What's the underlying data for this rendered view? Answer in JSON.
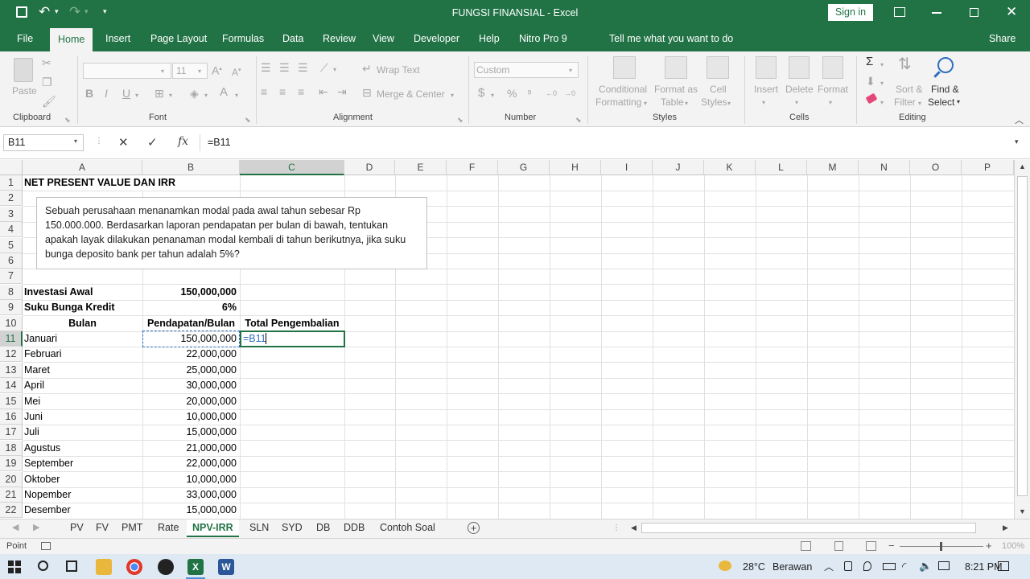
{
  "title_bar": {
    "title": "FUNGSI FINANSIAL  -  Excel",
    "sign_in": "Sign in"
  },
  "ribbon_tabs": [
    "File",
    "Home",
    "Insert",
    "Page Layout",
    "Formulas",
    "Data",
    "Review",
    "View",
    "Developer",
    "Help",
    "Nitro Pro 9"
  ],
  "tell_me": "Tell me what you want to do",
  "share": "Share",
  "ribbon": {
    "clipboard": {
      "label": "Clipboard",
      "paste": "Paste"
    },
    "font": {
      "label": "Font",
      "font_size": "11"
    },
    "alignment": {
      "label": "Alignment",
      "wrap_text": "Wrap Text",
      "merge_center": "Merge & Center"
    },
    "number": {
      "label": "Number",
      "format": "Custom"
    },
    "styles": {
      "label": "Styles",
      "conditional_1": "Conditional",
      "conditional_2": "Formatting",
      "format_as_1": "Format as",
      "format_as_2": "Table",
      "cell_styles_1": "Cell",
      "cell_styles_2": "Styles"
    },
    "cells": {
      "label": "Cells",
      "insert": "Insert",
      "delete": "Delete",
      "format": "Format"
    },
    "editing": {
      "label": "Editing",
      "sort_1": "Sort &",
      "sort_2": "Filter",
      "find_1": "Find &",
      "find_2": "Select"
    }
  },
  "formula_bar": {
    "name_box": "B11",
    "formula": "=B11"
  },
  "columns": [
    "A",
    "B",
    "C",
    "D",
    "E",
    "F",
    "G",
    "H",
    "I",
    "J",
    "K",
    "L",
    "M",
    "N",
    "O",
    "P"
  ],
  "rows": [
    "1",
    "2",
    "3",
    "4",
    "5",
    "6",
    "7",
    "8",
    "9",
    "10",
    "11",
    "12",
    "13",
    "14",
    "15",
    "16",
    "17",
    "18",
    "19",
    "20",
    "21",
    "22"
  ],
  "sheet": {
    "heading": "NET PRESENT VALUE DAN IRR",
    "textbox": "Sebuah perusahaan menanamkan modal pada awal tahun sebesar Rp 150.000.000. Berdasarkan laporan pendapatan per bulan di bawah, tentukan apakah layak dilakukan penanaman modal kembali di tahun berikutnya, jika suku bunga deposito bank per tahun adalah 5%?",
    "investasi_label": "Investasi Awal",
    "investasi_value": "150,000,000",
    "bunga_label": "Suku Bunga Kredit",
    "bunga_value": "6%",
    "header_bulan": "Bulan",
    "header_pendapatan": "Pendapatan/Bulan",
    "header_total": "Total Pengembalian",
    "editing_value": "=B11",
    "data_rows": [
      {
        "bulan": "Januari",
        "pendapatan": "150,000,000"
      },
      {
        "bulan": "Februari",
        "pendapatan": "22,000,000"
      },
      {
        "bulan": "Maret",
        "pendapatan": "25,000,000"
      },
      {
        "bulan": "April",
        "pendapatan": "30,000,000"
      },
      {
        "bulan": "Mei",
        "pendapatan": "20,000,000"
      },
      {
        "bulan": "Juni",
        "pendapatan": "10,000,000"
      },
      {
        "bulan": "Juli",
        "pendapatan": "15,000,000"
      },
      {
        "bulan": "Agustus",
        "pendapatan": "21,000,000"
      },
      {
        "bulan": "September",
        "pendapatan": "22,000,000"
      },
      {
        "bulan": "Oktober",
        "pendapatan": "10,000,000"
      },
      {
        "bulan": "Nopember",
        "pendapatan": "33,000,000"
      },
      {
        "bulan": "Desember",
        "pendapatan": "15,000,000"
      }
    ]
  },
  "sheet_tabs": [
    "PV",
    "FV",
    "PMT",
    "Rate",
    "NPV-IRR",
    "SLN",
    "SYD",
    "DB",
    "DDB",
    "Contoh Soal"
  ],
  "active_sheet": "NPV-IRR",
  "status": {
    "mode": "Point",
    "zoom": "100%"
  },
  "taskbar": {
    "weather_temp": "28°C",
    "weather_desc": "Berawan",
    "time": "8:21 PM"
  },
  "colors": {
    "excel_green": "#217346",
    "selection_blue": "#2f6fbf"
  }
}
